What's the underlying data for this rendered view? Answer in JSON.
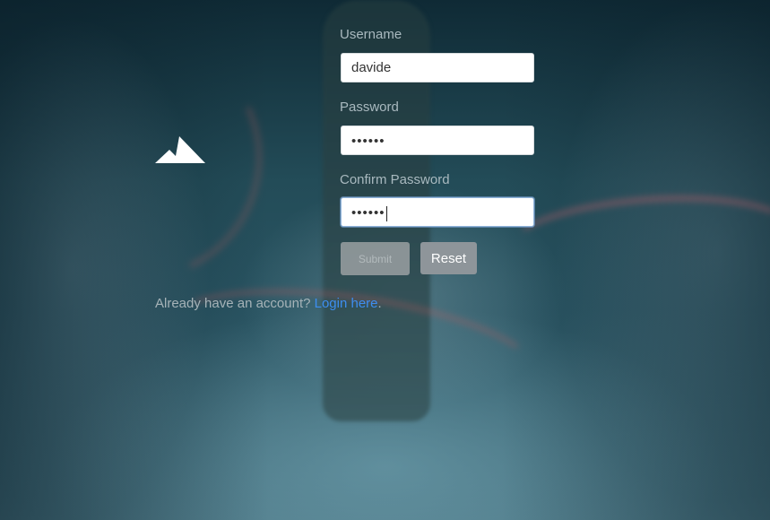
{
  "form": {
    "username_label": "Username",
    "username_value": "davide",
    "password_label": "Password",
    "password_value": "••••••",
    "confirm_label": "Confirm Password",
    "confirm_value": "••••••",
    "submit_label": "Submit",
    "reset_label": "Reset"
  },
  "footer": {
    "prompt": "Already have an account? ",
    "link": "Login here",
    "trailing": "."
  },
  "icons": {
    "logo": "mountain-icon"
  },
  "colors": {
    "link": "#3d8ef0",
    "label": "#a9b9bf",
    "submit_bg": "#9aa0a2",
    "reset_bg": "#8e959a"
  }
}
